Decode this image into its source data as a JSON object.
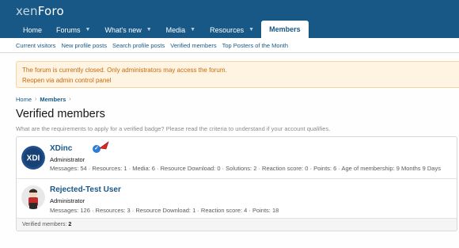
{
  "header": {
    "logo_prefix": "xen",
    "logo_suffix": "Foro",
    "nav": [
      {
        "label": "Home",
        "caret": false,
        "active": false
      },
      {
        "label": "Forums",
        "caret": true,
        "active": false
      },
      {
        "label": "What's new",
        "caret": true,
        "active": false
      },
      {
        "label": "Media",
        "caret": true,
        "active": false
      },
      {
        "label": "Resources",
        "caret": true,
        "active": false
      },
      {
        "label": "Members",
        "caret": false,
        "active": true
      }
    ]
  },
  "subnav": [
    "Current visitors",
    "New profile posts",
    "Search profile posts",
    "Verified members",
    "Top Posters of the Month"
  ],
  "notice": {
    "message": "The forum is currently closed. Only administrators may access the forum.",
    "link": "Reopen via admin control panel"
  },
  "breadcrumb": [
    "Home",
    "Members"
  ],
  "page": {
    "title": "Verified members",
    "description": "What are the requirements to apply for a verified badge? Please read the criteria to understand if your account qualifies."
  },
  "members": [
    {
      "name": "XDinc",
      "avatar_text": "XDI",
      "title": "Administrator",
      "stats": "Messages: 54 · Resources: 1 · Media: 6 · Resource Download: 0 · Solutions: 2 · Reaction score: 0 · Points: 6 · Age of membership: 9 Months 9 Days",
      "verified": true
    },
    {
      "name": "Rejected-Test User",
      "title": "Administrator",
      "stats": "Messages: 126 · Resources: 3 · Resource Download: 1 · Reaction score: 4 · Points: 18",
      "verified": false
    }
  ],
  "footer": {
    "label": "Verified members:",
    "count": "2"
  },
  "colors": {
    "header_bg": "#185886",
    "link": "#185886",
    "notice_bg": "#fef4e1",
    "notice_text": "#c76a0e",
    "verified_badge": "#2f7cd6"
  }
}
